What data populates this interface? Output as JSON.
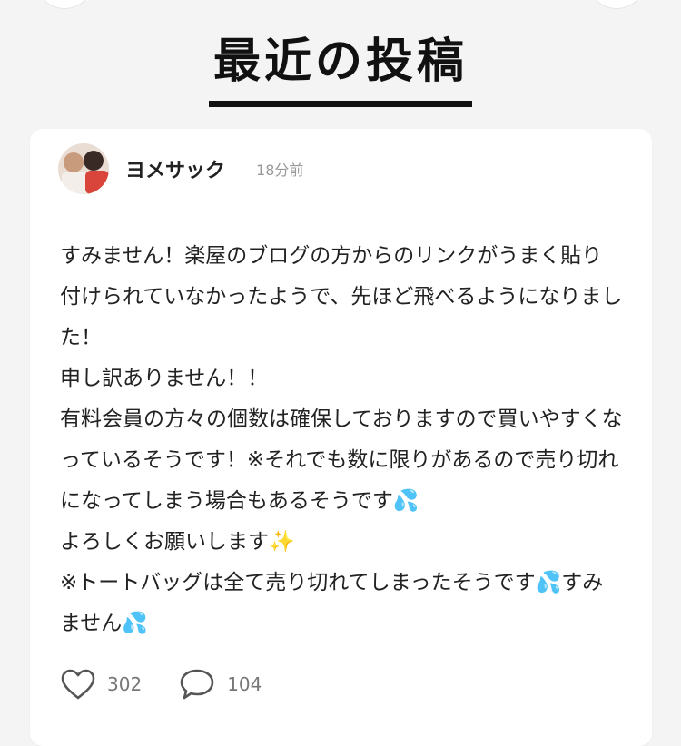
{
  "section": {
    "title": "最近の投稿"
  },
  "post": {
    "author": "ヨメサック",
    "time": "18分前",
    "body": "すみません！楽屋のブログの方からのリンクがうまく貼り付けられていなかったようで、先ほど飛べるようになりました！\n申し訳ありません！！\n有料会員の方々の個数は確保しておりますので買いやすくなっているそうです！※それでも数に限りがあるので売り切れになってしまう場合もあるそうです💦\nよろしくお願いします✨\n※トートバッグは全て売り切れてしまったそうです💦すみません💦",
    "likes": "302",
    "comments": "104"
  },
  "icons": {
    "like": "heart-icon",
    "comment": "speech-bubble-icon"
  }
}
